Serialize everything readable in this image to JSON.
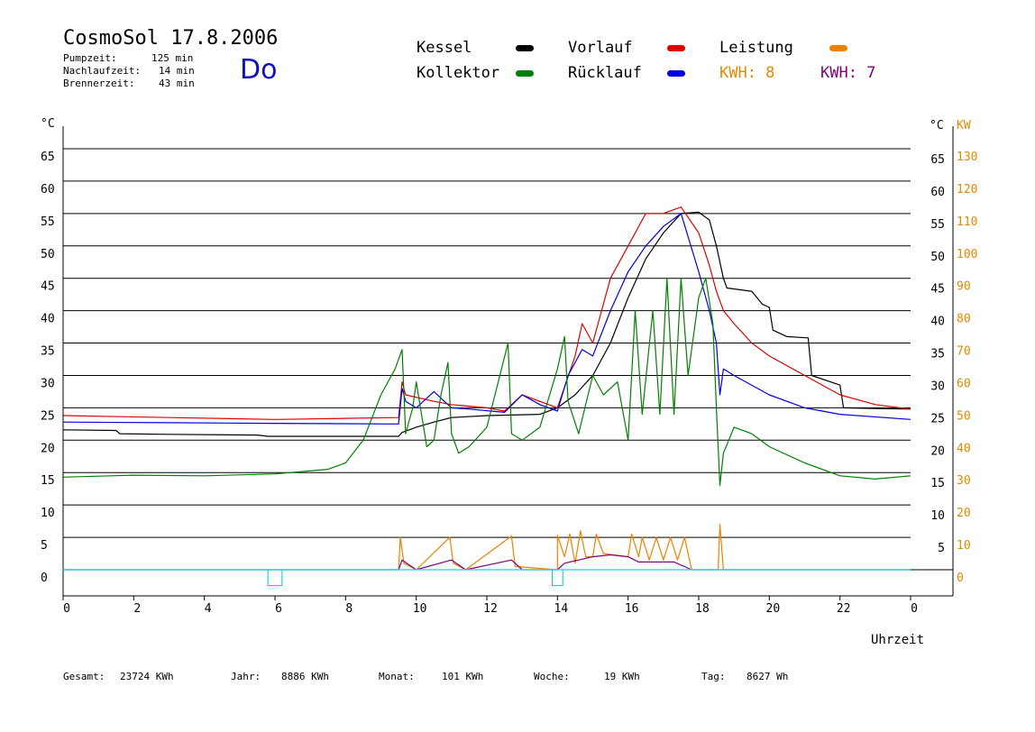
{
  "header": {
    "title": "CosmoSol 17.8.2006",
    "weekday": "Do",
    "stats": [
      {
        "label": "Pumpzeit:",
        "value": "125 min"
      },
      {
        "label": "Nachlaufzeit:",
        "value": "14 min"
      },
      {
        "label": "Brennerzeit:",
        "value": "43 min"
      }
    ]
  },
  "legend": {
    "items": [
      {
        "label": "Kessel",
        "color": "#000000"
      },
      {
        "label": "Vorlauf",
        "color": "#e00000"
      },
      {
        "label": "Leistung",
        "color": "#f08000"
      },
      {
        "label": "Kollektor",
        "color": "#008000"
      },
      {
        "label": "Rücklauf",
        "color": "#0000e0"
      }
    ],
    "kwh": [
      {
        "label": "KWH: 8",
        "color": "#e08a00"
      },
      {
        "label": "KWH: 7",
        "color": "#800080"
      }
    ]
  },
  "footer": [
    {
      "label": "Gesamt:",
      "value": "23724 KWh"
    },
    {
      "label": "Jahr:",
      "value": "8886 KWh"
    },
    {
      "label": "Monat:",
      "value": "101 KWh"
    },
    {
      "label": "Woche:",
      "value": "19 KWh"
    },
    {
      "label": "Tag:",
      "value": "8627 Wh"
    }
  ],
  "chart_data": {
    "type": "line",
    "xlabel": "Uhrzeit",
    "ylabel_left": "°C",
    "ylabel_right_temp": "°C",
    "ylabel_right_power": "KW",
    "x_ticks": [
      "0",
      "2",
      "4",
      "6",
      "8",
      "10",
      "12",
      "14",
      "16",
      "18",
      "20",
      "22",
      "0"
    ],
    "y_ticks_left": [
      "65",
      "60",
      "55",
      "50",
      "45",
      "40",
      "35",
      "30",
      "25",
      "20",
      "15",
      "10",
      "5",
      "0"
    ],
    "y_ticks_right_temp": [
      "65",
      "60",
      "55",
      "50",
      "45",
      "40",
      "35",
      "30",
      "25",
      "20",
      "15",
      "10",
      "5"
    ],
    "y_ticks_right_power": [
      "130",
      "120",
      "110",
      "100",
      "90",
      "80",
      "70",
      "60",
      "50",
      "40",
      "30",
      "20",
      "10",
      "0"
    ],
    "xlim": [
      0,
      24
    ],
    "ylim": [
      0,
      65
    ],
    "series": [
      {
        "name": "Kessel",
        "color": "#000000",
        "points": [
          [
            0,
            21.6
          ],
          [
            1.5,
            21.5
          ],
          [
            1.6,
            21
          ],
          [
            3,
            20.9
          ],
          [
            5.5,
            20.8
          ],
          [
            5.8,
            20.6
          ],
          [
            9.5,
            20.6
          ],
          [
            9.6,
            21.2
          ],
          [
            10,
            22
          ],
          [
            10.5,
            22.8
          ],
          [
            11,
            23.5
          ],
          [
            12,
            23.8
          ],
          [
            13.5,
            24
          ],
          [
            14,
            25
          ],
          [
            14.5,
            27
          ],
          [
            15,
            30
          ],
          [
            15.5,
            35
          ],
          [
            16,
            42
          ],
          [
            16.5,
            48
          ],
          [
            17,
            52
          ],
          [
            17.5,
            55
          ],
          [
            18,
            55.2
          ],
          [
            18.3,
            54
          ],
          [
            18.5,
            50
          ],
          [
            18.7,
            45
          ],
          [
            18.8,
            43.5
          ],
          [
            19.5,
            43
          ],
          [
            19.8,
            41
          ],
          [
            20,
            40.5
          ],
          [
            20.1,
            37
          ],
          [
            20.5,
            36
          ],
          [
            21.1,
            35.8
          ],
          [
            21.2,
            30
          ],
          [
            22,
            28.5
          ],
          [
            22.1,
            25
          ],
          [
            23,
            24.9
          ],
          [
            24,
            24.8
          ]
        ]
      },
      {
        "name": "Vorlauf",
        "color": "#e00000",
        "points": [
          [
            0,
            23.8
          ],
          [
            3,
            23.5
          ],
          [
            6,
            23.2
          ],
          [
            9.5,
            23.5
          ],
          [
            9.6,
            29
          ],
          [
            9.7,
            27
          ],
          [
            10.5,
            26
          ],
          [
            11,
            25.5
          ],
          [
            12,
            25
          ],
          [
            12.5,
            24.5
          ],
          [
            13,
            27
          ],
          [
            14,
            25
          ],
          [
            14.5,
            33
          ],
          [
            14.7,
            38
          ],
          [
            15,
            35
          ],
          [
            15.5,
            45
          ],
          [
            16,
            50
          ],
          [
            16.5,
            55
          ],
          [
            17,
            55
          ],
          [
            17.5,
            56
          ],
          [
            18,
            52
          ],
          [
            18.3,
            47
          ],
          [
            18.5,
            43
          ],
          [
            18.7,
            40
          ],
          [
            19,
            38
          ],
          [
            19.5,
            35
          ],
          [
            20,
            33
          ],
          [
            21,
            30
          ],
          [
            22,
            27
          ],
          [
            23,
            25.5
          ],
          [
            24,
            24.8
          ]
        ]
      },
      {
        "name": "Rücklauf",
        "color": "#0000e0",
        "points": [
          [
            0,
            22.8
          ],
          [
            3,
            22.7
          ],
          [
            6,
            22.6
          ],
          [
            9.5,
            22.5
          ],
          [
            9.6,
            28
          ],
          [
            9.7,
            26
          ],
          [
            10,
            25
          ],
          [
            10.5,
            27.5
          ],
          [
            11,
            25
          ],
          [
            11.5,
            24.8
          ],
          [
            12.5,
            24.3
          ],
          [
            13,
            27
          ],
          [
            13.5,
            25.5
          ],
          [
            14,
            24.5
          ],
          [
            14.3,
            30
          ],
          [
            14.7,
            34
          ],
          [
            15,
            33
          ],
          [
            15.5,
            40
          ],
          [
            16,
            46
          ],
          [
            16.5,
            50
          ],
          [
            17,
            53
          ],
          [
            17.5,
            55
          ],
          [
            18,
            46
          ],
          [
            18.3,
            40
          ],
          [
            18.5,
            35
          ],
          [
            18.6,
            27
          ],
          [
            18.7,
            31
          ],
          [
            19,
            30
          ],
          [
            20,
            27
          ],
          [
            21,
            25
          ],
          [
            22,
            24
          ],
          [
            24,
            23.2
          ]
        ]
      },
      {
        "name": "Kollektor",
        "color": "#008000",
        "points": [
          [
            0,
            14.3
          ],
          [
            2,
            14.6
          ],
          [
            4,
            14.5
          ],
          [
            6,
            14.8
          ],
          [
            7.5,
            15.5
          ],
          [
            8,
            16.5
          ],
          [
            8.5,
            20
          ],
          [
            9,
            27
          ],
          [
            9.4,
            31
          ],
          [
            9.6,
            34
          ],
          [
            9.7,
            21
          ],
          [
            9.9,
            25
          ],
          [
            10,
            29
          ],
          [
            10.3,
            19
          ],
          [
            10.5,
            20
          ],
          [
            10.7,
            27
          ],
          [
            10.9,
            32
          ],
          [
            11,
            21
          ],
          [
            11.2,
            18
          ],
          [
            11.5,
            19
          ],
          [
            12,
            22
          ],
          [
            12.6,
            35
          ],
          [
            12.7,
            21
          ],
          [
            13,
            20
          ],
          [
            13.5,
            22
          ],
          [
            14,
            31
          ],
          [
            14.2,
            36
          ],
          [
            14.3,
            26
          ],
          [
            14.6,
            21
          ],
          [
            15,
            30
          ],
          [
            15.3,
            27
          ],
          [
            15.7,
            29
          ],
          [
            16,
            20
          ],
          [
            16.2,
            40
          ],
          [
            16.4,
            24
          ],
          [
            16.7,
            40
          ],
          [
            16.9,
            24
          ],
          [
            17.1,
            45
          ],
          [
            17.3,
            24
          ],
          [
            17.5,
            45
          ],
          [
            17.7,
            30
          ],
          [
            18,
            42
          ],
          [
            18.2,
            45
          ],
          [
            18.4,
            38
          ],
          [
            18.5,
            25
          ],
          [
            18.6,
            13
          ],
          [
            18.7,
            18
          ],
          [
            19,
            22
          ],
          [
            19.5,
            21
          ],
          [
            20,
            19
          ],
          [
            21,
            16.5
          ],
          [
            22,
            14.5
          ],
          [
            23,
            14
          ],
          [
            24,
            14.5
          ]
        ]
      },
      {
        "name": "Leistung",
        "color": "#f08000",
        "axis": "right",
        "points": [
          [
            0,
            0
          ],
          [
            9.5,
            0
          ],
          [
            9.55,
            5
          ],
          [
            9.65,
            1
          ],
          [
            10,
            0
          ],
          [
            10.95,
            5
          ],
          [
            11.05,
            1
          ],
          [
            11.4,
            0
          ],
          [
            12.7,
            5.2
          ],
          [
            12.8,
            0.5
          ],
          [
            14,
            0
          ],
          [
            14,
            5.3
          ],
          [
            14.2,
            2
          ],
          [
            14.35,
            5.5
          ],
          [
            14.5,
            1
          ],
          [
            14.65,
            6
          ],
          [
            14.8,
            2
          ],
          [
            15,
            2
          ],
          [
            15.1,
            5.5
          ],
          [
            15.3,
            2.5
          ],
          [
            16,
            2
          ],
          [
            16.1,
            5.5
          ],
          [
            16.3,
            2
          ],
          [
            16.4,
            5
          ],
          [
            16.6,
            1.5
          ],
          [
            16.8,
            5
          ],
          [
            17,
            1.5
          ],
          [
            17.2,
            5
          ],
          [
            17.4,
            1.5
          ],
          [
            17.6,
            5
          ],
          [
            17.8,
            0
          ],
          [
            18.55,
            0
          ],
          [
            18.6,
            7
          ],
          [
            18.7,
            0
          ],
          [
            24,
            0
          ]
        ]
      },
      {
        "name": "Leistung2",
        "color": "#800080",
        "axis": "right",
        "points": [
          [
            0,
            0
          ],
          [
            9.5,
            0
          ],
          [
            9.6,
            1.5
          ],
          [
            10,
            0
          ],
          [
            11,
            1.5
          ],
          [
            11.4,
            0
          ],
          [
            12.7,
            1.5
          ],
          [
            13,
            0
          ],
          [
            14,
            0
          ],
          [
            14.2,
            1
          ],
          [
            14.6,
            1.5
          ],
          [
            15,
            2
          ],
          [
            15.5,
            2.3
          ],
          [
            16,
            2
          ],
          [
            16.3,
            1.2
          ],
          [
            16.8,
            1.2
          ],
          [
            17.3,
            1.2
          ],
          [
            17.8,
            0
          ],
          [
            24,
            0
          ]
        ]
      }
    ],
    "markers": [
      {
        "name": "Tarif 1",
        "x_start": 5.8,
        "x_end": 6.2,
        "y_bottom": -0.5,
        "y_top": 0,
        "color": "#00c8c8"
      },
      {
        "name": "Tarif 2",
        "x_start": 13.85,
        "x_end": 14.15,
        "y_bottom": -0.5,
        "y_top": 0,
        "color": "#00c8c8"
      }
    ],
    "baseline": {
      "y": 0,
      "color": "#40d8e0"
    },
    "grid": true
  }
}
